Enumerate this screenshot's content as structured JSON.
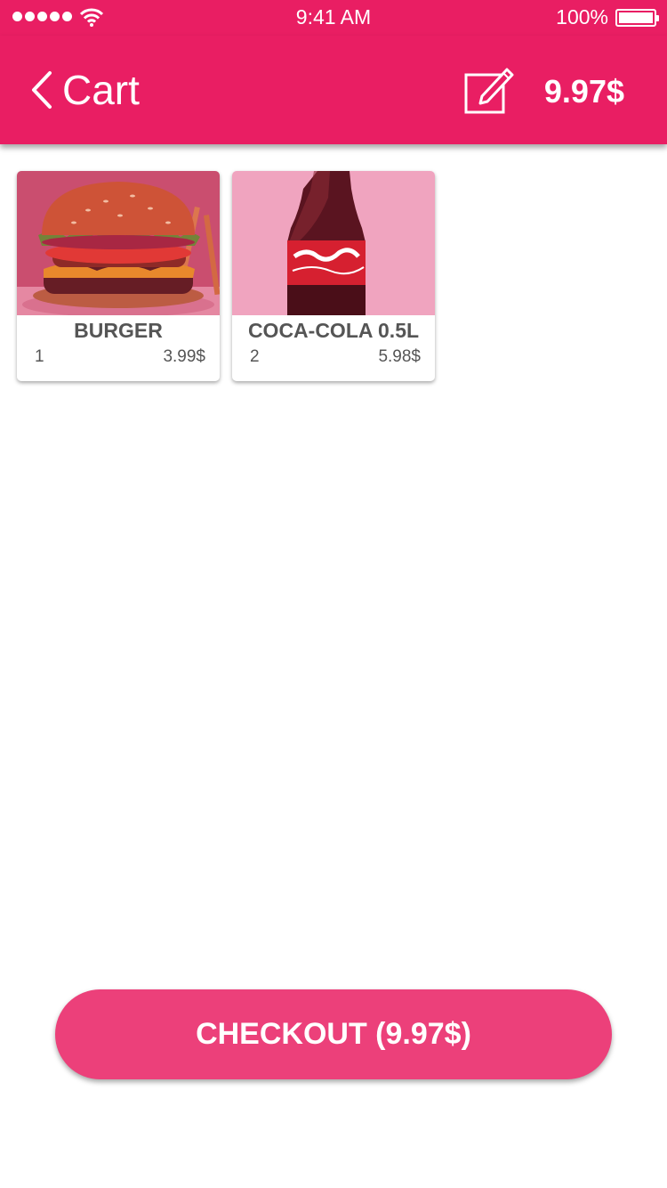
{
  "status_bar": {
    "time": "9:41 AM",
    "battery": "100%"
  },
  "nav": {
    "back_label": "Cart",
    "total": "9.97$"
  },
  "cart": {
    "items": [
      {
        "name": "BURGER",
        "quantity": "1",
        "price": "3.99$",
        "image": "burger-photo"
      },
      {
        "name": "COCA-COLA 0.5L",
        "quantity": "2",
        "price": "5.98$",
        "image": "coca-cola-bottle-photo"
      }
    ]
  },
  "checkout": {
    "label": "CHECKOUT (9.97$)"
  },
  "colors": {
    "primary": "#e91e63",
    "button": "#ec407a",
    "text_gray": "#555555"
  }
}
